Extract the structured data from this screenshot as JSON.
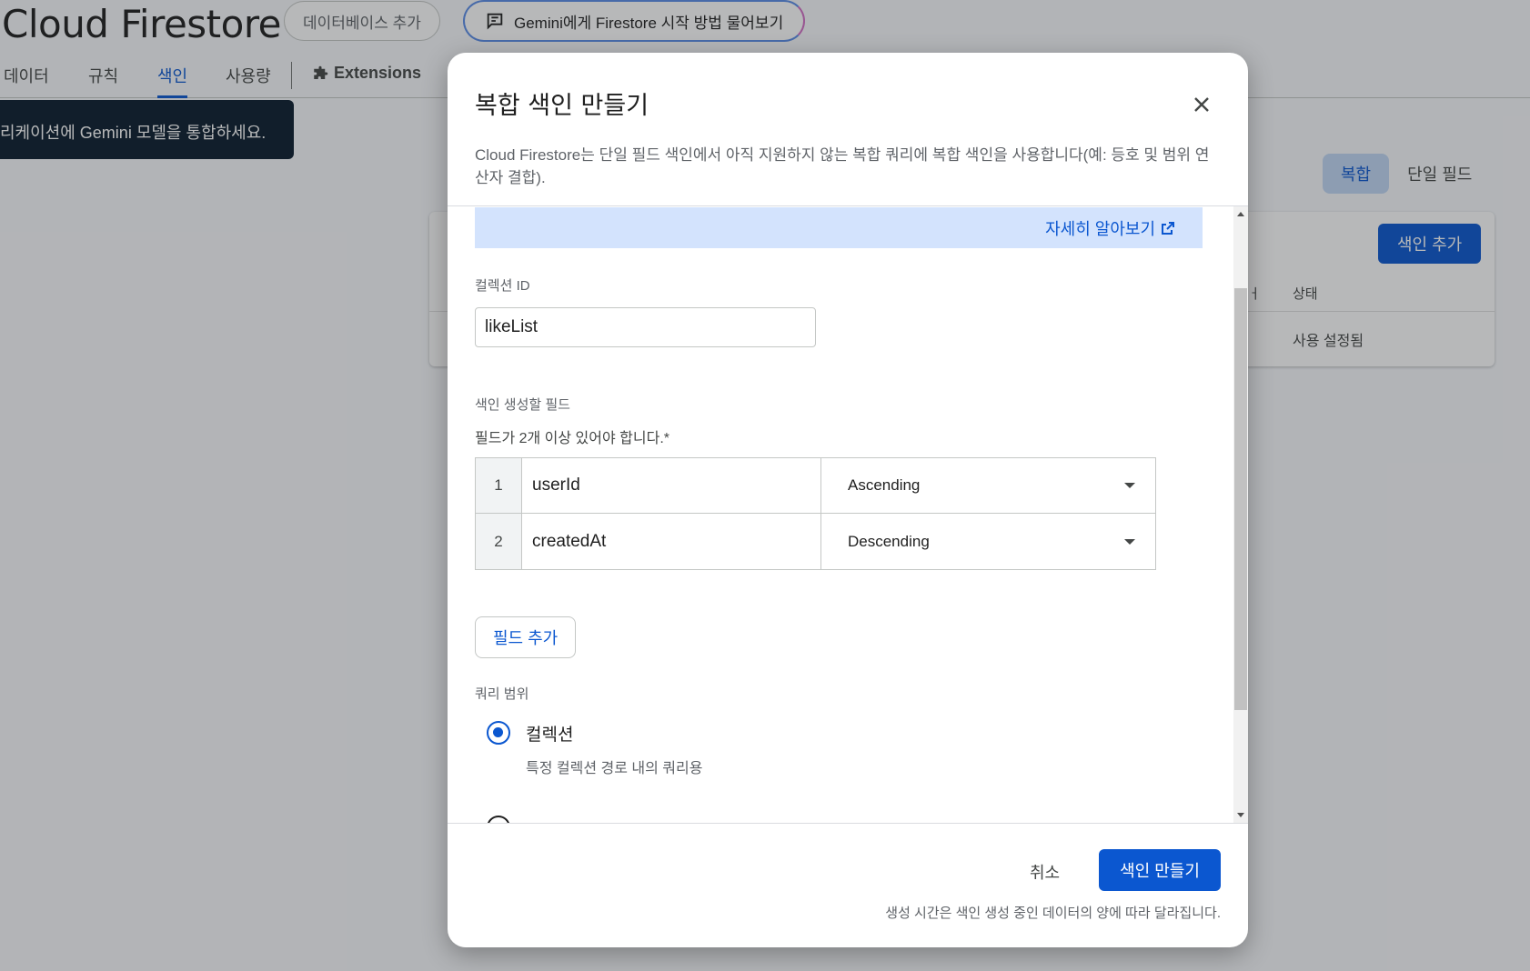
{
  "background": {
    "app_title": "Cloud Firestore",
    "add_database_label": "데이터베이스 추가",
    "gemini_chip_label": "Gemini에게 Firestore 시작 방법 물어보기",
    "tabs": [
      {
        "label": "데이터"
      },
      {
        "label": "규칙"
      },
      {
        "label": "색인"
      },
      {
        "label": "사용량"
      }
    ],
    "extensions_label": "Extensions",
    "toast_text": "리케이션에 Gemini 모델을 통합하세요.",
    "segment": {
      "composite": "복합",
      "single": "단일 필드"
    },
    "add_index_label": "색인 추가",
    "table": {
      "header_fragment": "ㅓ",
      "header_status": "상태",
      "row_status": "사용 설정됨"
    }
  },
  "dialog": {
    "title": "복합 색인 만들기",
    "description": "Cloud Firestore는 단일 필드 색인에서 아직 지원하지 않는 복합 쿼리에 복합 색인을 사용합니다(예: 등호 및 범위 연산자 결합).",
    "learn_more": "자세히 알아보기",
    "collection_id_label": "컬렉션 ID",
    "collection_id_value": "likeList",
    "fields_label": "색인 생성할 필드",
    "fields_requirement": "필드가 2개 이상 있어야 합니다.*",
    "fields": [
      {
        "index": "1",
        "name": "userId",
        "order": "Ascending"
      },
      {
        "index": "2",
        "name": "createdAt",
        "order": "Descending"
      }
    ],
    "add_field_label": "필드 추가",
    "query_scope_label": "쿼리 범위",
    "scope_option": {
      "label": "컬렉션",
      "description": "특정 컬렉션 경로 내의 쿼리용"
    },
    "cancel_label": "취소",
    "create_label": "색인 만들기",
    "footnote": "생성 시간은 색인 생성 중인 데이터의 양에 따라 달라집니다."
  },
  "colors": {
    "accent": "#0b57d0",
    "banner": "#d3e3fd",
    "toast": "#0b1d2e"
  }
}
